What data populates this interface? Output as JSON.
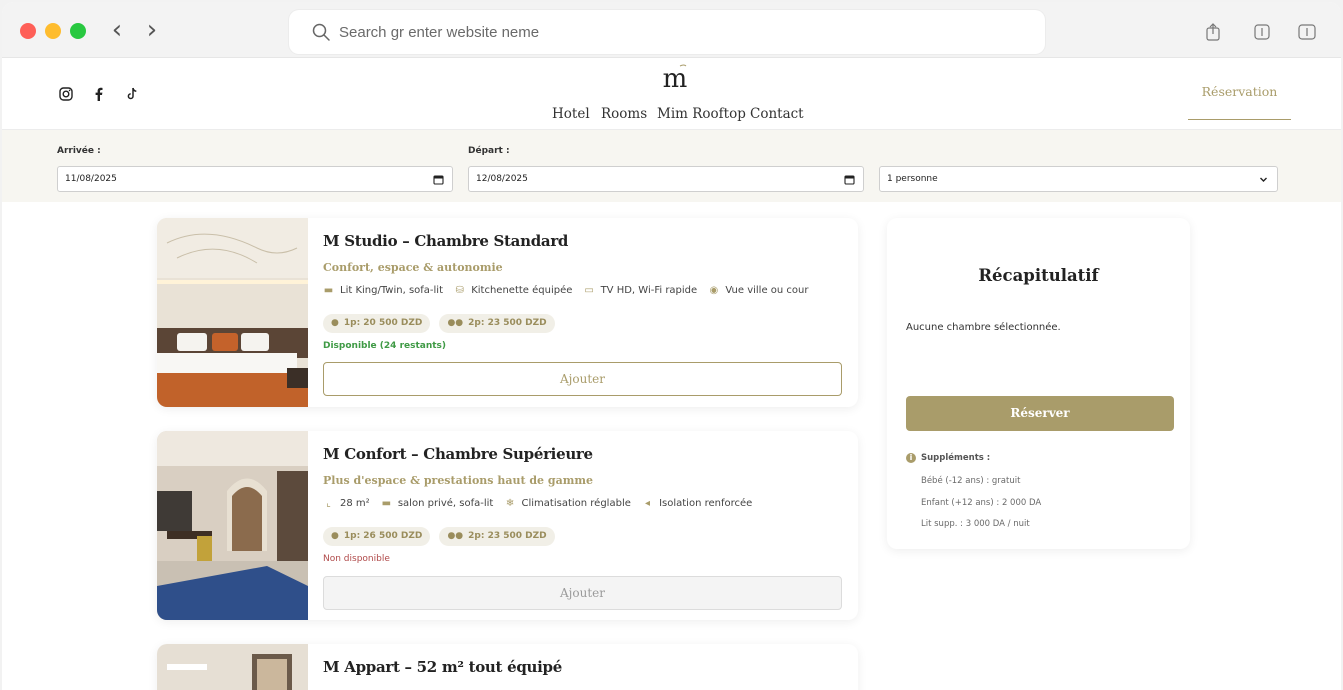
{
  "browser": {
    "search_placeholder": "Search gr enter website neme"
  },
  "header": {
    "logo_text": "m",
    "nav": [
      "Hotel",
      "Rooms",
      "Mim Rooftop",
      "Contact"
    ],
    "reservation_link": "Réservation",
    "social_icons": [
      "instagram-icon",
      "facebook-icon",
      "tiktok-icon"
    ]
  },
  "filter": {
    "arrival_label": "Arrivée :",
    "arrival_value": "11/08/2025",
    "departure_label": "Départ :",
    "departure_value": "12/08/2025",
    "guests_value": "1 personne"
  },
  "rooms": [
    {
      "title": "M Studio – Chambre Standard",
      "subtitle": "Confort, espace & autonomie",
      "features": [
        "Lit King/Twin, sofa-lit",
        "Kitchenette équipée",
        "TV HD, Wi-Fi rapide",
        "Vue ville ou cour"
      ],
      "price_1p": "1p: 20 500 DZD",
      "price_2p": "2p: 23 500 DZD",
      "status": "Disponible (24 restants)",
      "button": "Ajouter"
    },
    {
      "title": "M Confort – Chambre Supérieure",
      "subtitle": "Plus d'espace & prestations haut de gamme",
      "features": [
        "28 m²",
        "salon privé, sofa-lit",
        "Climatisation réglable",
        "Isolation renforcée"
      ],
      "price_1p": "1p: 26 500 DZD",
      "price_2p": "2p: 23 500 DZD",
      "status": "Non disponible",
      "button": "Ajouter"
    },
    {
      "title": "M Appart – 52 m² tout équipé"
    }
  ],
  "recap": {
    "title": "Récapitulatif",
    "empty_text": "Aucune chambre sélectionnée.",
    "button": "Réserver",
    "supplements_title": "Suppléments :",
    "supplements": [
      "Bébé (-12 ans) : gratuit",
      "Enfant (+12 ans) : 2 000 DA",
      "Lit supp. : 3 000 DA / nuit"
    ]
  },
  "colors": {
    "accent": "#a99c6a",
    "available": "#3f9a45",
    "unavailable": "#b04a4a"
  }
}
